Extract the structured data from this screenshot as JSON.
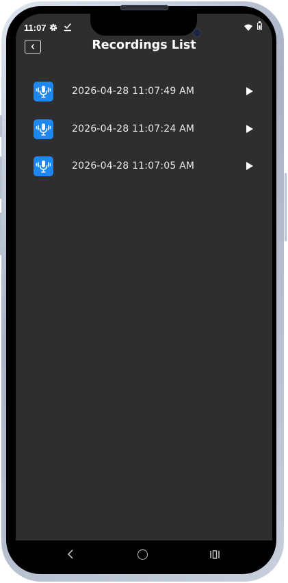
{
  "status_bar": {
    "time": "11:07",
    "icons": [
      "gear-icon",
      "checkmark-download-icon",
      "wifi-icon",
      "battery-icon"
    ]
  },
  "header": {
    "title": "Recordings List",
    "back_icon": "chevron-left-icon"
  },
  "recordings": [
    {
      "label": "2026-04-28 11:07:49 AM",
      "icon": "microphone-icon",
      "action_icon": "play-icon"
    },
    {
      "label": "2026-04-28 11:07:24 AM",
      "icon": "microphone-icon",
      "action_icon": "play-icon"
    },
    {
      "label": "2026-04-28 11:07:05 AM",
      "icon": "microphone-icon",
      "action_icon": "play-icon"
    }
  ],
  "nav_bar": {
    "icons": [
      "nav-back-icon",
      "nav-home-icon",
      "nav-recents-icon"
    ]
  },
  "colors": {
    "screen_background": "#2e2e2e",
    "icon_accent": "#1e88f0",
    "text": "#e9e9e9"
  }
}
